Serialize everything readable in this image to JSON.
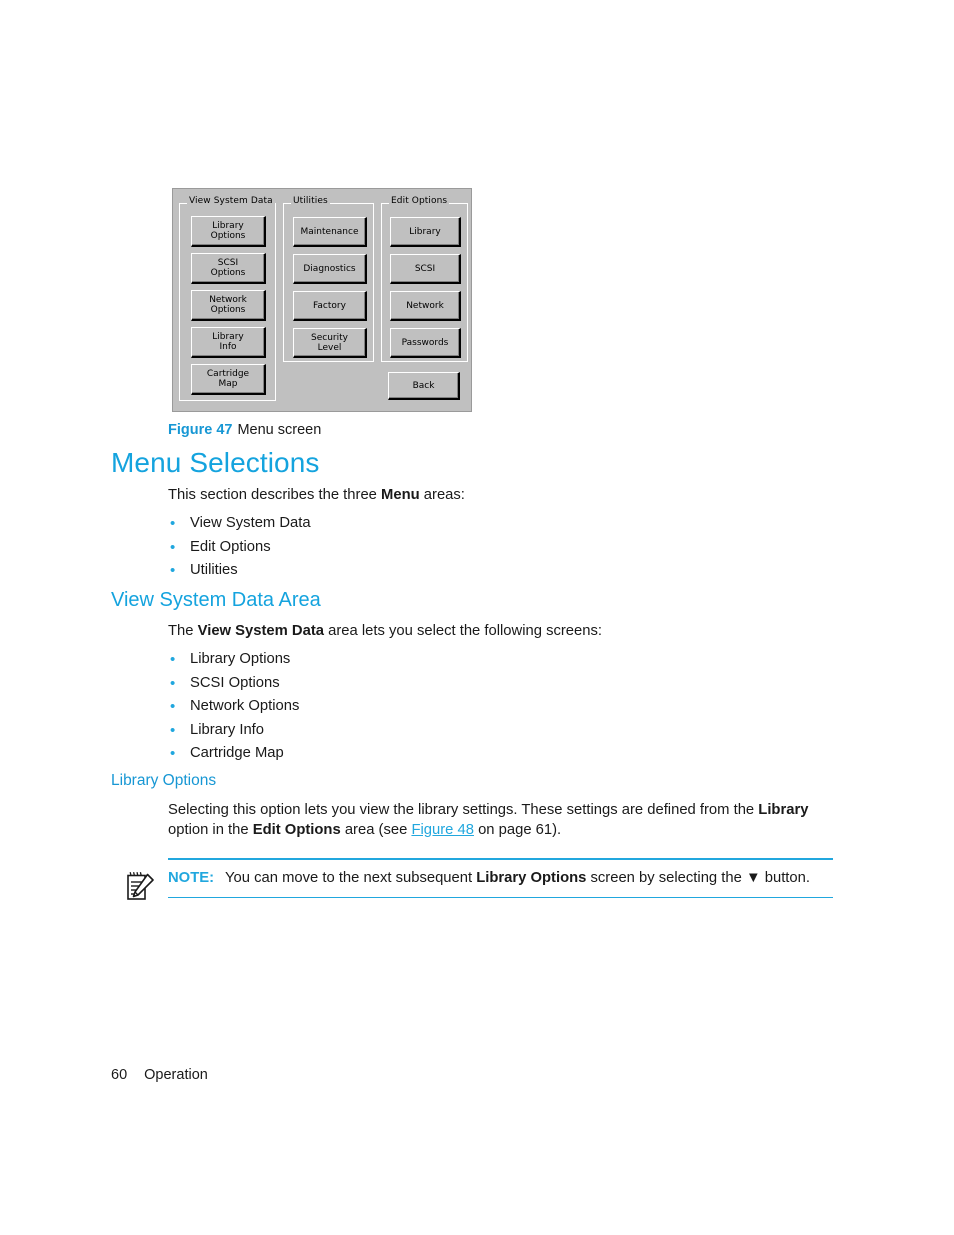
{
  "figure": {
    "caption_number": "Figure 47",
    "caption_title": "Menu screen",
    "screen": {
      "groups": [
        {
          "id": "view-system-data",
          "label": "View System Data",
          "buttons": [
            {
              "id": "library-options",
              "line1": "Library",
              "line2": "Options"
            },
            {
              "id": "scsi-options",
              "line1": "SCSI",
              "line2": "Options"
            },
            {
              "id": "network-options",
              "line1": "Network",
              "line2": "Options"
            },
            {
              "id": "library-info",
              "line1": "Library",
              "line2": "Info"
            },
            {
              "id": "cartridge-map",
              "line1": "Cartridge",
              "line2": "Map"
            }
          ]
        },
        {
          "id": "utilities",
          "label": "Utilities",
          "buttons": [
            {
              "id": "maintenance",
              "line1": "Maintenance",
              "line2": ""
            },
            {
              "id": "diagnostics",
              "line1": "Diagnostics",
              "line2": ""
            },
            {
              "id": "factory",
              "line1": "Factory",
              "line2": ""
            },
            {
              "id": "security-level",
              "line1": "Security",
              "line2": "Level"
            }
          ]
        },
        {
          "id": "edit-options",
          "label": "Edit Options",
          "buttons": [
            {
              "id": "edit-library",
              "line1": "Library",
              "line2": ""
            },
            {
              "id": "edit-scsi",
              "line1": "SCSI",
              "line2": ""
            },
            {
              "id": "edit-network",
              "line1": "Network",
              "line2": ""
            },
            {
              "id": "edit-passwords",
              "line1": "Passwords",
              "line2": ""
            }
          ]
        }
      ],
      "back_button": "Back"
    }
  },
  "headings": {
    "menu_selections": "Menu Selections",
    "view_system_data_area": "View System Data Area",
    "library_options": "Library Options"
  },
  "paragraphs": {
    "intro_pre": "This section describes the three ",
    "intro_bold": "Menu",
    "intro_post": " areas:",
    "vsd_pre": "The ",
    "vsd_bold": "View System Data",
    "vsd_post": " area lets you select the following screens:",
    "libopt_seg1": "Selecting this option lets you view the library settings. These settings are defined from the ",
    "libopt_bold1": "Library",
    "libopt_seg2": " option in the ",
    "libopt_bold2": "Edit Options",
    "libopt_seg3": " area (see ",
    "libopt_link": "Figure 48",
    "libopt_seg4": " on page 61)."
  },
  "lists": {
    "menu_areas": [
      "View System Data",
      "Edit Options",
      "Utilities"
    ],
    "view_system_data_items": [
      "Library Options",
      "SCSI Options",
      "Network Options",
      "Library Info",
      "Cartridge Map"
    ]
  },
  "note": {
    "label": "NOTE:",
    "text_pre": "You can move to the next subsequent ",
    "text_bold": "Library Options",
    "text_mid": " screen by selecting the ",
    "arrow": "▼",
    "text_post": " button."
  },
  "footer": {
    "page_number": "60",
    "chapter": "Operation"
  },
  "colors": {
    "accent": "#14a3de",
    "link": "#21a7de",
    "caption_number": "#1797d4",
    "lcd_face": "#c0c0c0",
    "text": "#1a1a1a"
  }
}
